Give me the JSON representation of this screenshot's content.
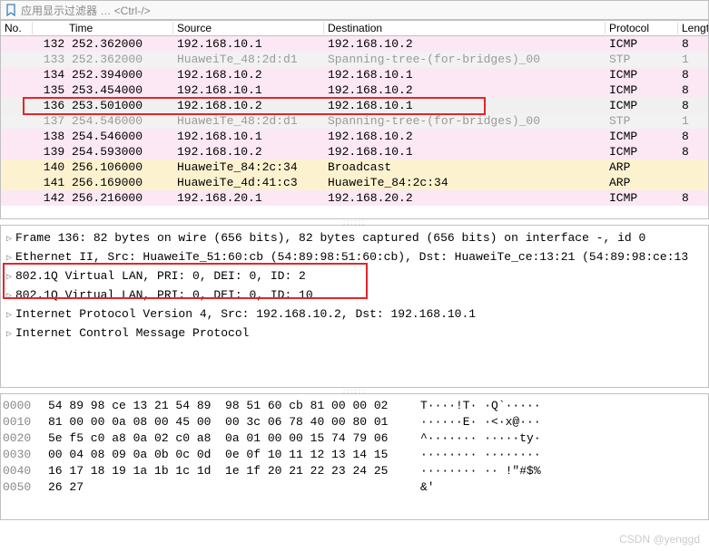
{
  "filter": {
    "placeholder": "应用显示过滤器 … <Ctrl-/>"
  },
  "columns": {
    "no": "No.",
    "time": "Time",
    "source": "Source",
    "destination": "Destination",
    "protocol": "Protocol",
    "length": "Lengt"
  },
  "packets": [
    {
      "no": "132",
      "time": "252.362000",
      "src": "192.168.10.1",
      "dst": "192.168.10.2",
      "proto": "ICMP",
      "len": "8",
      "cls": "row-pink"
    },
    {
      "no": "133",
      "time": "252.362000",
      "src": "HuaweiTe_48:2d:d1",
      "dst": "Spanning-tree-(for-bridges)_00",
      "proto": "STP",
      "len": "1",
      "cls": "row-gray"
    },
    {
      "no": "134",
      "time": "252.394000",
      "src": "192.168.10.2",
      "dst": "192.168.10.1",
      "proto": "ICMP",
      "len": "8",
      "cls": "row-pink"
    },
    {
      "no": "135",
      "time": "253.454000",
      "src": "192.168.10.1",
      "dst": "192.168.10.2",
      "proto": "ICMP",
      "len": "8",
      "cls": "row-pink"
    },
    {
      "no": "136",
      "time": "253.501000",
      "src": "192.168.10.2",
      "dst": "192.168.10.1",
      "proto": "ICMP",
      "len": "8",
      "cls": "row-selected"
    },
    {
      "no": "137",
      "time": "254.546000",
      "src": "HuaweiTe_48:2d:d1",
      "dst": "Spanning-tree-(for-bridges)_00",
      "proto": "STP",
      "len": "1",
      "cls": "row-gray"
    },
    {
      "no": "138",
      "time": "254.546000",
      "src": "192.168.10.1",
      "dst": "192.168.10.2",
      "proto": "ICMP",
      "len": "8",
      "cls": "row-pink"
    },
    {
      "no": "139",
      "time": "254.593000",
      "src": "192.168.10.2",
      "dst": "192.168.10.1",
      "proto": "ICMP",
      "len": "8",
      "cls": "row-pink"
    },
    {
      "no": "140",
      "time": "256.106000",
      "src": "HuaweiTe_84:2c:34",
      "dst": "Broadcast",
      "proto": "ARP",
      "len": "",
      "cls": "row-yellow"
    },
    {
      "no": "141",
      "time": "256.169000",
      "src": "HuaweiTe_4d:41:c3",
      "dst": "HuaweiTe_84:2c:34",
      "proto": "ARP",
      "len": "",
      "cls": "row-yellow"
    },
    {
      "no": "142",
      "time": "256.216000",
      "src": "192.168.20.1",
      "dst": "192.168.20.2",
      "proto": "ICMP",
      "len": "8",
      "cls": "row-pink"
    }
  ],
  "details": [
    "Frame 136: 82 bytes on wire (656 bits), 82 bytes captured (656 bits) on interface -, id 0",
    "Ethernet II, Src: HuaweiTe_51:60:cb (54:89:98:51:60:cb), Dst: HuaweiTe_ce:13:21 (54:89:98:ce:13",
    "802.1Q Virtual LAN, PRI: 0, DEI: 0, ID: 2",
    "802.1Q Virtual LAN, PRI: 0, DEI: 0, ID: 10",
    "Internet Protocol Version 4, Src: 192.168.10.2, Dst: 192.168.10.1",
    "Internet Control Message Protocol"
  ],
  "hex": [
    {
      "off": "0000",
      "b": "54 89 98 ce 13 21 54 89  98 51 60 cb 81 00 00 02",
      "a": "T····!T· ·Q`·····"
    },
    {
      "off": "0010",
      "b": "81 00 00 0a 08 00 45 00  00 3c 06 78 40 00 80 01",
      "a": "······E· ·<·x@···"
    },
    {
      "off": "0020",
      "b": "5e f5 c0 a8 0a 02 c0 a8  0a 01 00 00 15 74 79 06",
      "a": "^······· ·····ty·"
    },
    {
      "off": "0030",
      "b": "00 04 08 09 0a 0b 0c 0d  0e 0f 10 11 12 13 14 15",
      "a": "········ ········"
    },
    {
      "off": "0040",
      "b": "16 17 18 19 1a 1b 1c 1d  1e 1f 20 21 22 23 24 25",
      "a": "········ ·· !\"#$%"
    },
    {
      "off": "0050",
      "b": "26 27",
      "a": "&'"
    }
  ],
  "watermark": "CSDN @yenggd"
}
